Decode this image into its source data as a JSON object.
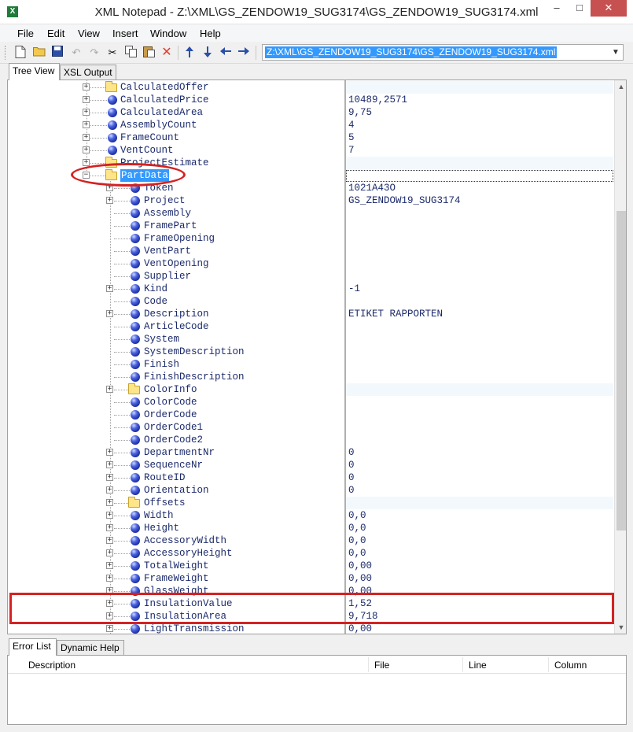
{
  "window": {
    "app_icon": "X",
    "title": "XML Notepad - Z:\\XML\\GS_ZENDOW19_SUG3174\\GS_ZENDOW19_SUG3174.xml",
    "minimize": "–",
    "maximize": "□",
    "close": "✕"
  },
  "menu": [
    "File",
    "Edit",
    "View",
    "Insert",
    "Window",
    "Help"
  ],
  "toolbar": {
    "address": "Z:\\XML\\GS_ZENDOW19_SUG3174\\GS_ZENDOW19_SUG3174.xml",
    "buttons": [
      "new-file-icon",
      "open-folder-icon",
      "save-icon",
      "undo-icon",
      "redo-icon",
      "cut-icon",
      "copy-icon",
      "paste-icon",
      "delete-icon",
      "nudge-up-icon",
      "nudge-down-icon",
      "nudge-left-icon",
      "nudge-right-icon"
    ]
  },
  "tabs": {
    "tree_view": "Tree View",
    "xsl_output": "XSL Output"
  },
  "tree": {
    "rows": [
      {
        "label": "CalculatedOffer",
        "value": "",
        "type": "folder",
        "level": 0,
        "expander": "+"
      },
      {
        "label": "CalculatedPrice",
        "value": "10489,2571",
        "type": "element",
        "level": 0,
        "expander": "+"
      },
      {
        "label": "CalculatedArea",
        "value": "9,75",
        "type": "element",
        "level": 0,
        "expander": "+"
      },
      {
        "label": "AssemblyCount",
        "value": "4",
        "type": "element",
        "level": 0,
        "expander": "+"
      },
      {
        "label": "FrameCount",
        "value": "5",
        "type": "element",
        "level": 0,
        "expander": "+"
      },
      {
        "label": "VentCount",
        "value": "7",
        "type": "element",
        "level": 0,
        "expander": "+"
      },
      {
        "label": "ProjectEstimate",
        "value": "",
        "type": "folder",
        "level": 0,
        "expander": "+"
      },
      {
        "label": "PartData",
        "value": "",
        "type": "folder",
        "level": 0,
        "expander": "−",
        "selected": true
      },
      {
        "label": "Token",
        "value": "1021A43O",
        "type": "element",
        "level": 1,
        "expander": "+"
      },
      {
        "label": "Project",
        "value": "GS_ZENDOW19_SUG3174",
        "type": "element",
        "level": 1,
        "expander": "+"
      },
      {
        "label": "Assembly",
        "value": "",
        "type": "element",
        "level": 1,
        "expander": ""
      },
      {
        "label": "FramePart",
        "value": "",
        "type": "element",
        "level": 1,
        "expander": ""
      },
      {
        "label": "FrameOpening",
        "value": "",
        "type": "element",
        "level": 1,
        "expander": ""
      },
      {
        "label": "VentPart",
        "value": "",
        "type": "element",
        "level": 1,
        "expander": ""
      },
      {
        "label": "VentOpening",
        "value": "",
        "type": "element",
        "level": 1,
        "expander": ""
      },
      {
        "label": "Supplier",
        "value": "",
        "type": "element",
        "level": 1,
        "expander": ""
      },
      {
        "label": "Kind",
        "value": "-1",
        "type": "element",
        "level": 1,
        "expander": "+"
      },
      {
        "label": "Code",
        "value": "",
        "type": "element",
        "level": 1,
        "expander": ""
      },
      {
        "label": "Description",
        "value": "ETIKET RAPPORTEN",
        "type": "element",
        "level": 1,
        "expander": "+"
      },
      {
        "label": "ArticleCode",
        "value": "",
        "type": "element",
        "level": 1,
        "expander": ""
      },
      {
        "label": "System",
        "value": "",
        "type": "element",
        "level": 1,
        "expander": ""
      },
      {
        "label": "SystemDescription",
        "value": "",
        "type": "element",
        "level": 1,
        "expander": ""
      },
      {
        "label": "Finish",
        "value": "",
        "type": "element",
        "level": 1,
        "expander": ""
      },
      {
        "label": "FinishDescription",
        "value": "",
        "type": "element",
        "level": 1,
        "expander": ""
      },
      {
        "label": "ColorInfo",
        "value": "",
        "type": "folder",
        "level": 1,
        "expander": "+"
      },
      {
        "label": "ColorCode",
        "value": "",
        "type": "element",
        "level": 1,
        "expander": ""
      },
      {
        "label": "OrderCode",
        "value": "",
        "type": "element",
        "level": 1,
        "expander": ""
      },
      {
        "label": "OrderCode1",
        "value": "",
        "type": "element",
        "level": 1,
        "expander": ""
      },
      {
        "label": "OrderCode2",
        "value": "",
        "type": "element",
        "level": 1,
        "expander": ""
      },
      {
        "label": "DepartmentNr",
        "value": "0",
        "type": "element",
        "level": 1,
        "expander": "+"
      },
      {
        "label": "SequenceNr",
        "value": "0",
        "type": "element",
        "level": 1,
        "expander": "+"
      },
      {
        "label": "RouteID",
        "value": "0",
        "type": "element",
        "level": 1,
        "expander": "+"
      },
      {
        "label": "Orientation",
        "value": "0",
        "type": "element",
        "level": 1,
        "expander": "+"
      },
      {
        "label": "Offsets",
        "value": "",
        "type": "folder",
        "level": 1,
        "expander": "+"
      },
      {
        "label": "Width",
        "value": "0,0",
        "type": "element",
        "level": 1,
        "expander": "+"
      },
      {
        "label": "Height",
        "value": "0,0",
        "type": "element",
        "level": 1,
        "expander": "+"
      },
      {
        "label": "AccessoryWidth",
        "value": "0,0",
        "type": "element",
        "level": 1,
        "expander": "+"
      },
      {
        "label": "AccessoryHeight",
        "value": "0,0",
        "type": "element",
        "level": 1,
        "expander": "+"
      },
      {
        "label": "TotalWeight",
        "value": "0,00",
        "type": "element",
        "level": 1,
        "expander": "+"
      },
      {
        "label": "FrameWeight",
        "value": "0,00",
        "type": "element",
        "level": 1,
        "expander": "+"
      },
      {
        "label": "GlassWeight",
        "value": "0,00",
        "type": "element",
        "level": 1,
        "expander": "+"
      },
      {
        "label": "InsulationValue",
        "value": "1,52",
        "type": "element",
        "level": 1,
        "expander": "+"
      },
      {
        "label": "InsulationArea",
        "value": "9,718",
        "type": "element",
        "level": 1,
        "expander": "+"
      },
      {
        "label": "LightTransmission",
        "value": "0,00",
        "type": "element",
        "level": 1,
        "expander": "+"
      }
    ]
  },
  "bottom_tabs": {
    "error_list": "Error List",
    "dynamic_help": "Dynamic Help"
  },
  "error_list": {
    "columns": [
      "Description",
      "File",
      "Line",
      "Column"
    ]
  }
}
